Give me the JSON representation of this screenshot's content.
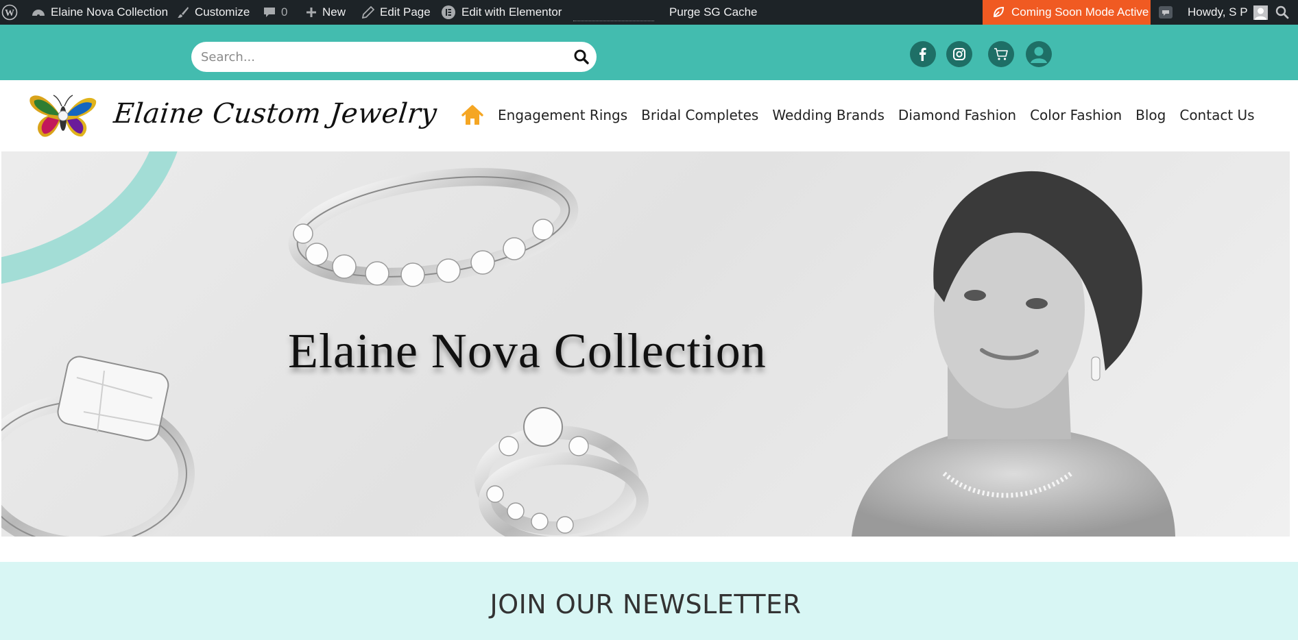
{
  "admin_bar": {
    "site_name": "Elaine Nova Collection",
    "customize": "Customize",
    "comments_count": "0",
    "new": "New",
    "edit_page": "Edit Page",
    "edit_elementor": "Edit with Elementor",
    "purge_cache": "Purge SG Cache",
    "coming_soon": "Coming Soon Mode Active",
    "howdy": "Howdy, S P",
    "coming_soon_color": "#f05a22"
  },
  "topbar": {
    "search_placeholder": "Search...",
    "background": "#43bcaf",
    "icons": [
      "facebook-icon",
      "instagram-icon",
      "cart-icon",
      "account-icon"
    ]
  },
  "header": {
    "logo_text": "Elaine Custom Jewelry",
    "nav": [
      "Engagement Rings",
      "Bridal Completes",
      "Wedding Brands",
      "Diamond Fashion",
      "Color Fashion",
      "Blog",
      "Contact Us"
    ],
    "home_icon_color": "#f5a623"
  },
  "hero": {
    "title": "Elaine Nova Collection"
  },
  "newsletter": {
    "heading": "JOIN OUR NEWSLETTER",
    "background": "#d8f6f4"
  }
}
